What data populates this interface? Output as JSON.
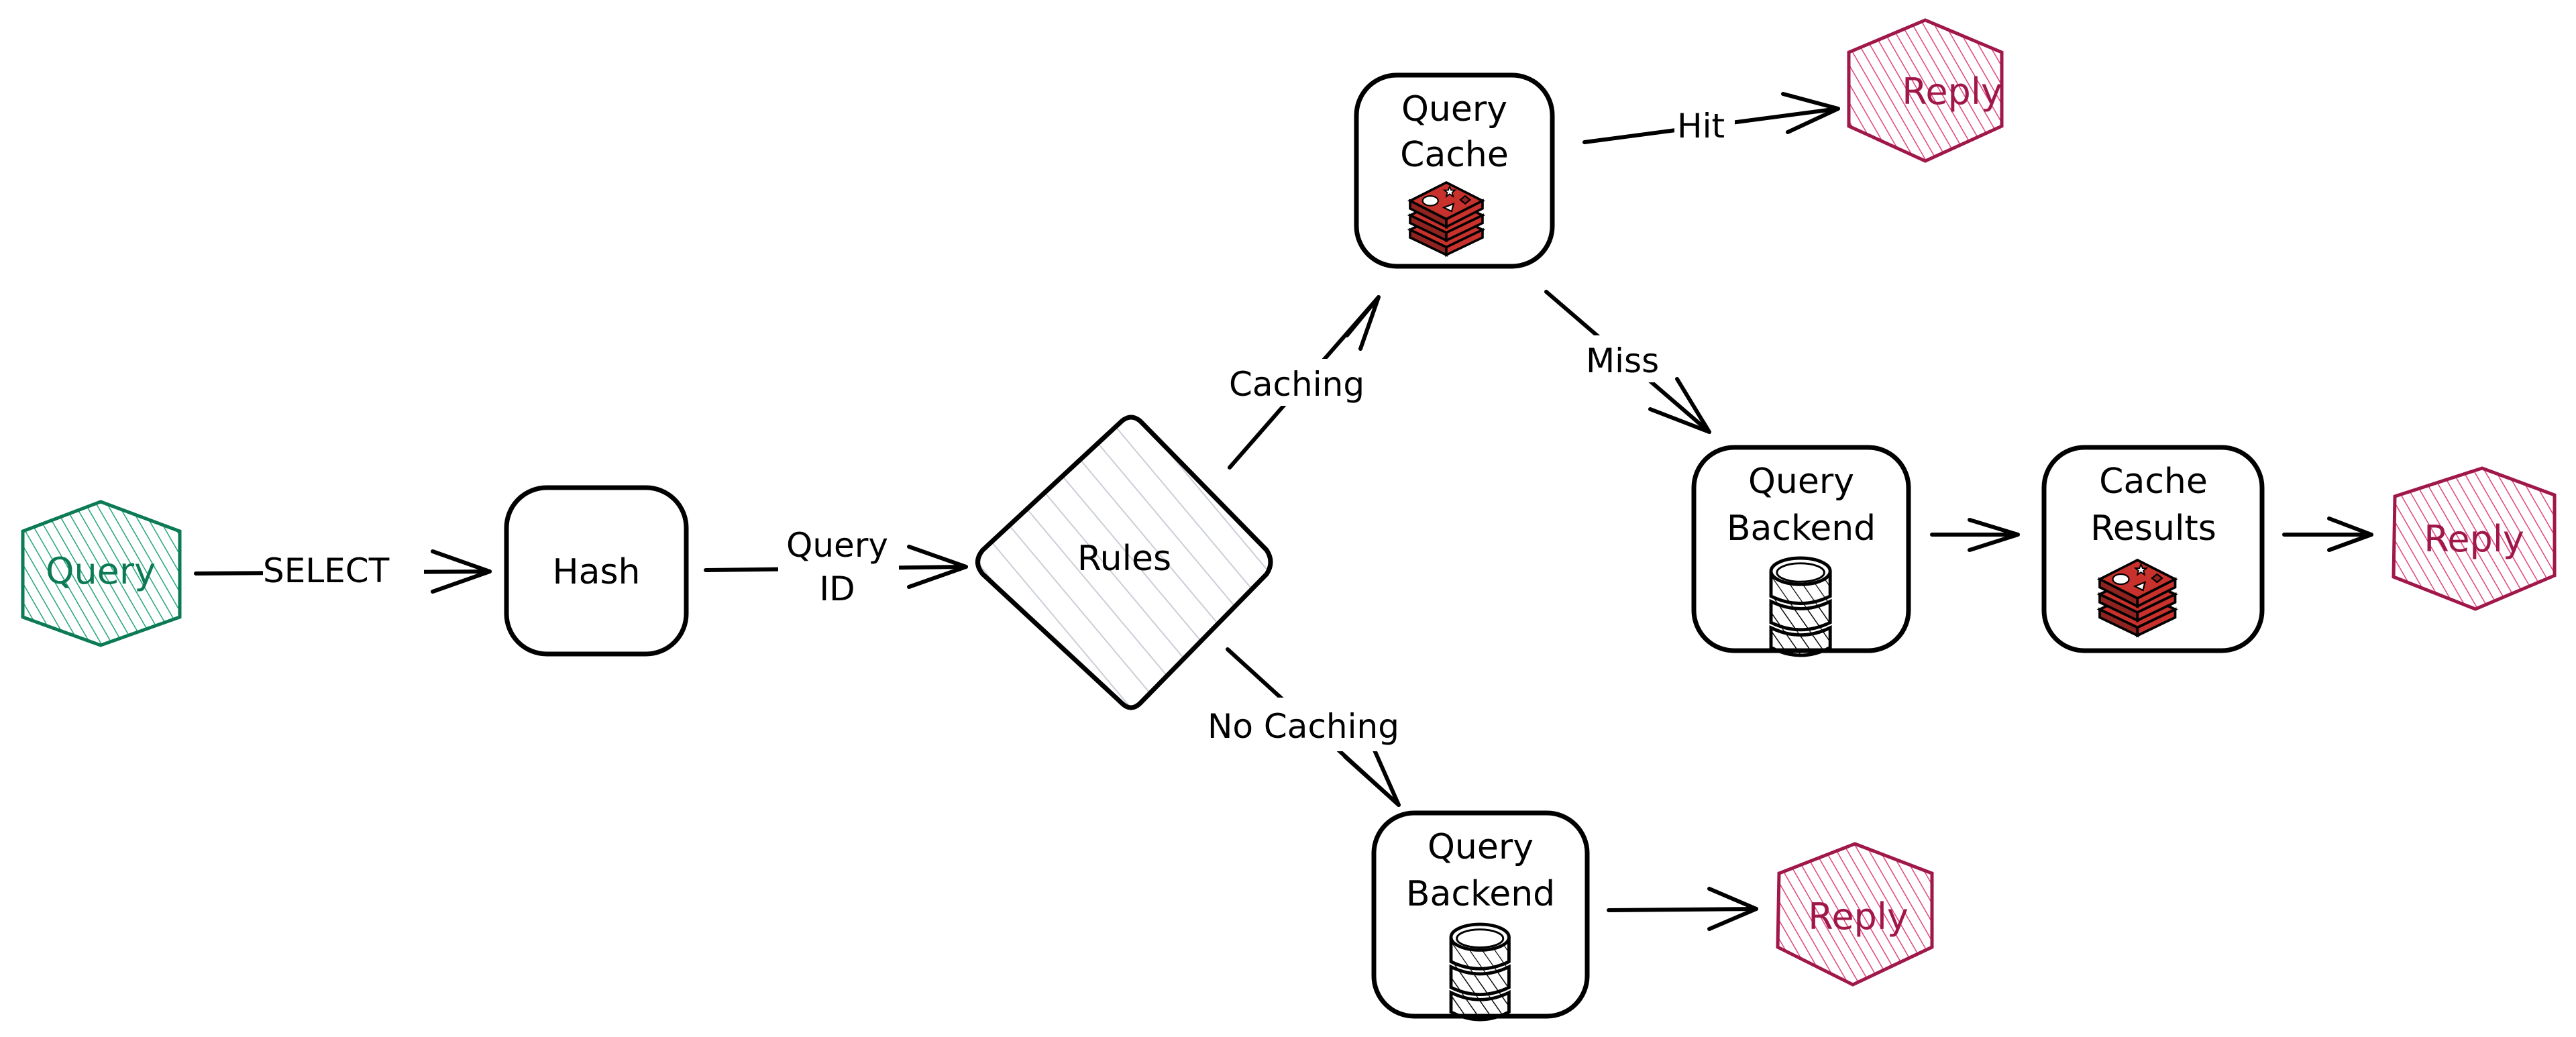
{
  "diagram": {
    "type": "flowchart",
    "style": "hand-drawn",
    "colors": {
      "start": "#0b7a55",
      "start_fill": "#22a677",
      "reply": "#a0174a",
      "reply_fill": "#e0457a",
      "redis_red": "#c8312c",
      "redis_dark": "#8f2320",
      "rules_hatch": "#c9cfd6",
      "ink": "#000000"
    },
    "nodes": {
      "query": {
        "label": "Query",
        "shape": "hexagon",
        "icon": null
      },
      "hash": {
        "label": "Hash",
        "shape": "rounded-rectangle"
      },
      "rules": {
        "label": "Rules",
        "shape": "diamond"
      },
      "query_cache": {
        "label_line1": "Query",
        "label_line2": "Cache",
        "shape": "rounded-rectangle",
        "icon": "redis-stack-icon"
      },
      "reply_hit": {
        "label": "Reply",
        "shape": "hexagon"
      },
      "query_backend_miss": {
        "label_line1": "Query",
        "label_line2": "Backend",
        "shape": "rounded-rectangle",
        "icon": "database-icon"
      },
      "cache_results": {
        "label_line1": "Cache",
        "label_line2": "Results",
        "shape": "rounded-rectangle",
        "icon": "redis-stack-icon"
      },
      "reply_miss": {
        "label": "Reply",
        "shape": "hexagon"
      },
      "query_backend_nocache": {
        "label_line1": "Query",
        "label_line2": "Backend",
        "shape": "rounded-rectangle",
        "icon": "database-icon"
      },
      "reply_nocache": {
        "label": "Reply",
        "shape": "hexagon"
      }
    },
    "edges": [
      {
        "from": "query",
        "to": "hash",
        "label": "SELECT"
      },
      {
        "from": "hash",
        "to": "rules",
        "label_line1": "Query",
        "label_line2": "ID"
      },
      {
        "from": "rules",
        "to": "query_cache",
        "label": "Caching"
      },
      {
        "from": "rules",
        "to": "query_backend_nocache",
        "label": "No Caching"
      },
      {
        "from": "query_cache",
        "to": "reply_hit",
        "label": "Hit"
      },
      {
        "from": "query_cache",
        "to": "query_backend_miss",
        "label": "Miss"
      },
      {
        "from": "query_backend_miss",
        "to": "cache_results",
        "label": ""
      },
      {
        "from": "cache_results",
        "to": "reply_miss",
        "label": ""
      },
      {
        "from": "query_backend_nocache",
        "to": "reply_nocache",
        "label": ""
      }
    ]
  }
}
